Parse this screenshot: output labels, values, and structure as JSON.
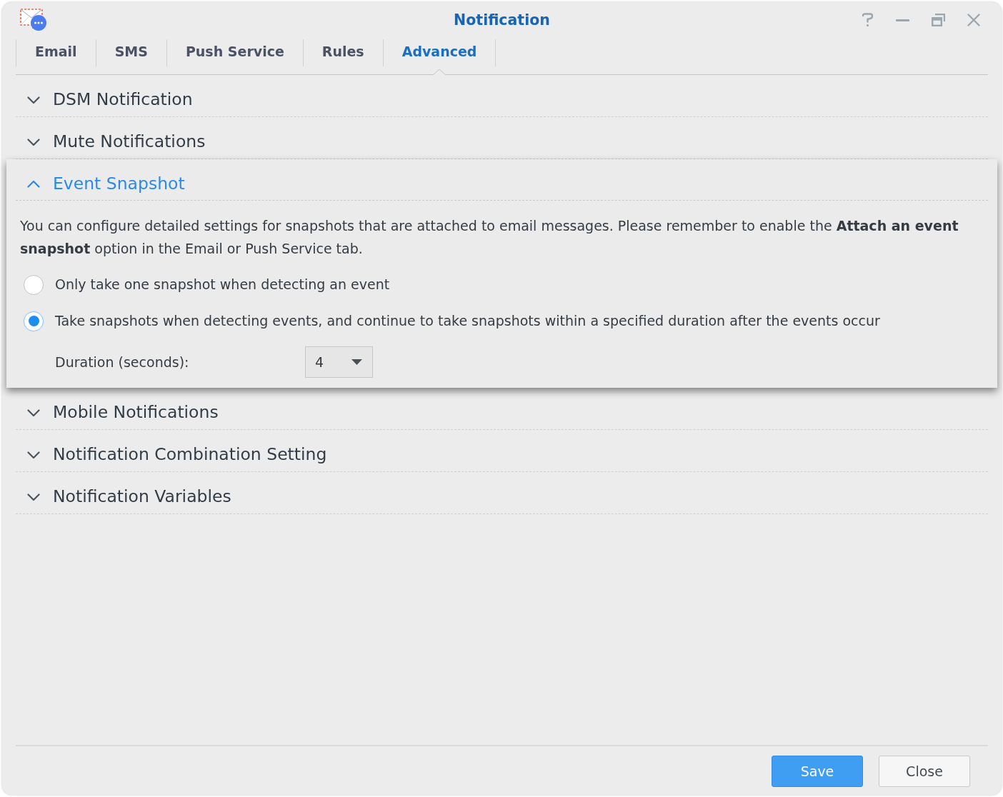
{
  "window": {
    "title": "Notification"
  },
  "tabs": [
    {
      "label": "Email",
      "selected": false
    },
    {
      "label": "SMS",
      "selected": false
    },
    {
      "label": "Push Service",
      "selected": false
    },
    {
      "label": "Rules",
      "selected": false
    },
    {
      "label": "Advanced",
      "selected": true
    }
  ],
  "sections": [
    {
      "title": "DSM Notification",
      "expanded": false
    },
    {
      "title": "Mute Notifications",
      "expanded": false
    },
    {
      "title": "Event Snapshot",
      "expanded": true,
      "description": "You can configure detailed settings for snapshots that are attached to email messages. Please remember to enable the **Attach an event snapshot** option in the Email or Push Service tab.",
      "options": [
        {
          "label": "Only take one snapshot when detecting an event",
          "selected": false
        },
        {
          "label": "Take snapshots when detecting events, and continue to take snapshots within a specified duration after the events occur",
          "selected": true
        }
      ],
      "duration": {
        "label": "Duration (seconds):",
        "value": "4"
      }
    },
    {
      "title": "Mobile Notifications",
      "expanded": false
    },
    {
      "title": "Notification Combination Setting",
      "expanded": false
    },
    {
      "title": "Notification Variables",
      "expanded": false
    }
  ],
  "buttons": [
    {
      "label": "Save",
      "kind": "primary"
    },
    {
      "label": "Close",
      "kind": "secondary"
    }
  ]
}
